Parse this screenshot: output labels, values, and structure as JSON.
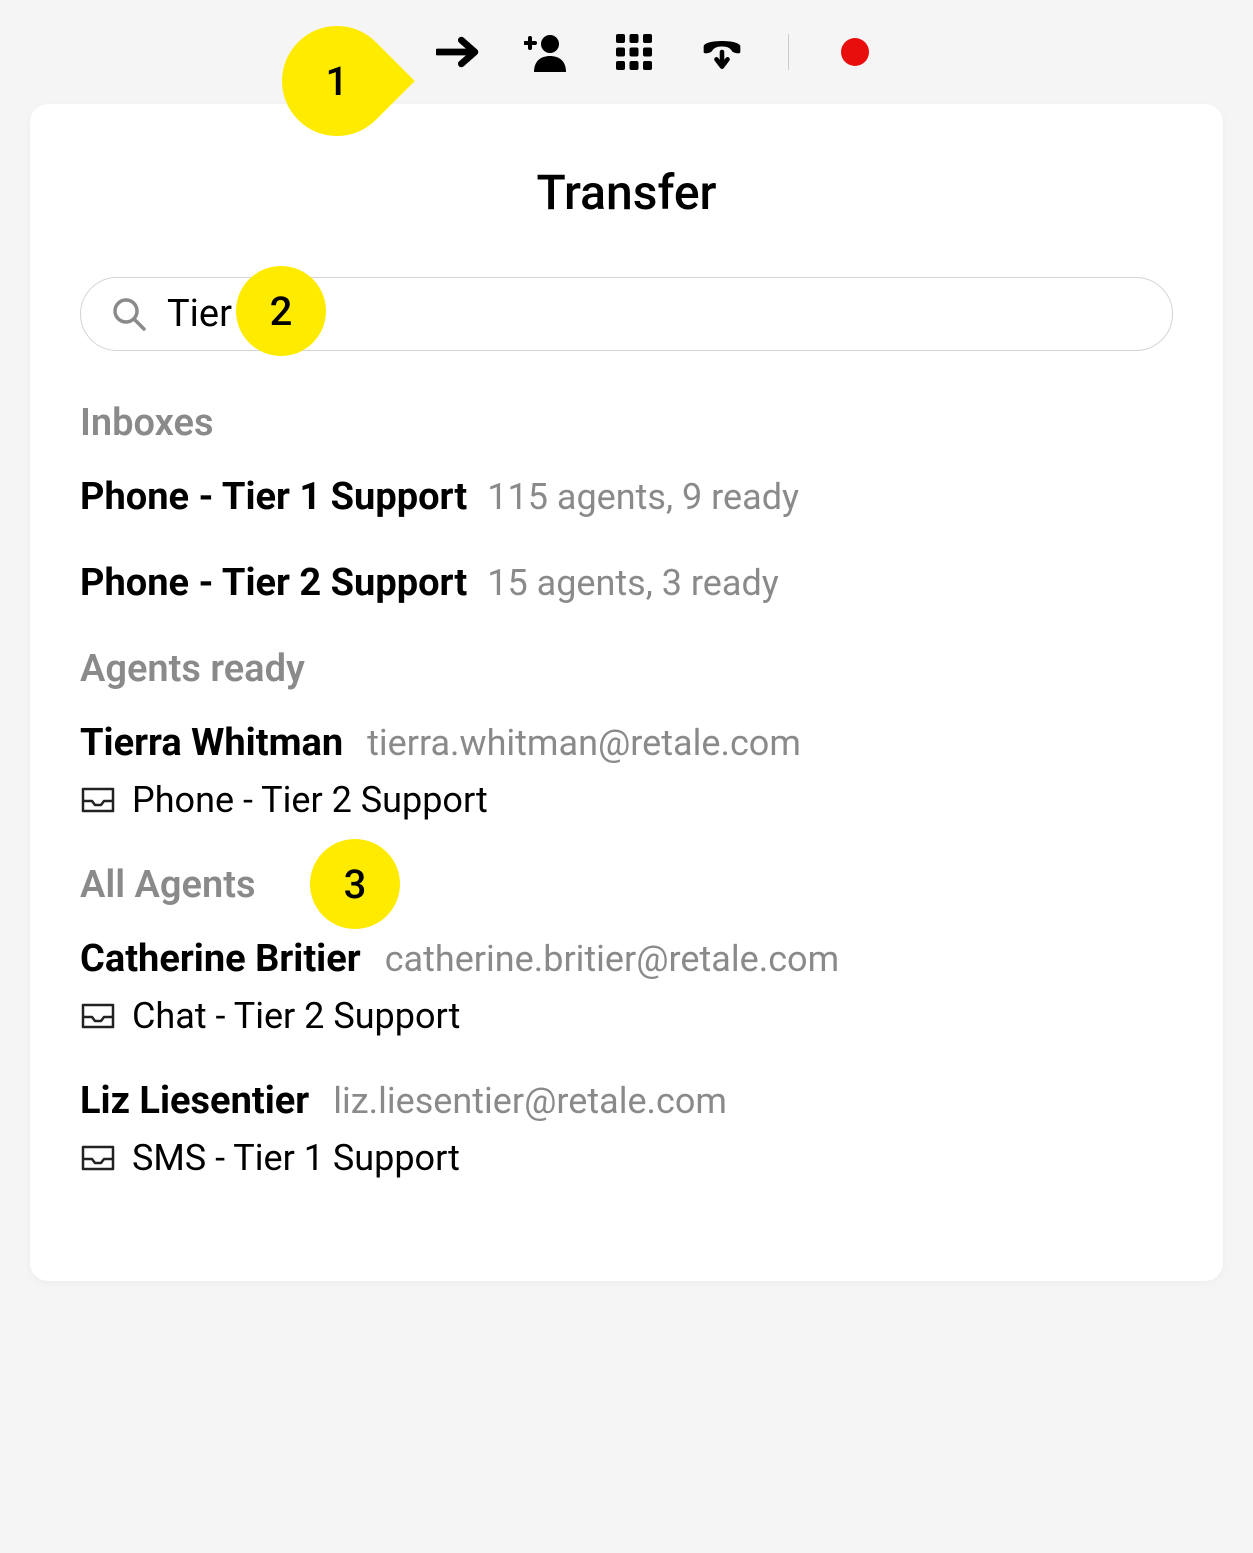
{
  "header": {
    "title": "Transfer"
  },
  "search": {
    "value": "Tier"
  },
  "sections": {
    "inboxes_label": "Inboxes",
    "agents_ready_label": "Agents ready",
    "all_agents_label": "All Agents"
  },
  "inboxes": [
    {
      "name": "Phone - Tier 1 Support",
      "status": "115 agents, 9 ready"
    },
    {
      "name": "Phone - Tier 2 Support",
      "status": "15 agents, 3 ready"
    }
  ],
  "agents_ready": [
    {
      "name": "Tierra Whitman",
      "email": "tierra.whitman@retale.com",
      "queue": "Phone - Tier 2 Support"
    }
  ],
  "all_agents": [
    {
      "name": "Catherine Britier",
      "email": "catherine.britier@retale.com",
      "queue": "Chat - Tier 2 Support"
    },
    {
      "name": "Liz Liesentier",
      "email": "liz.liesentier@retale.com",
      "queue": "SMS - Tier 1 Support"
    }
  ],
  "callouts": {
    "c1": "1",
    "c2": "2",
    "c3": "3"
  }
}
